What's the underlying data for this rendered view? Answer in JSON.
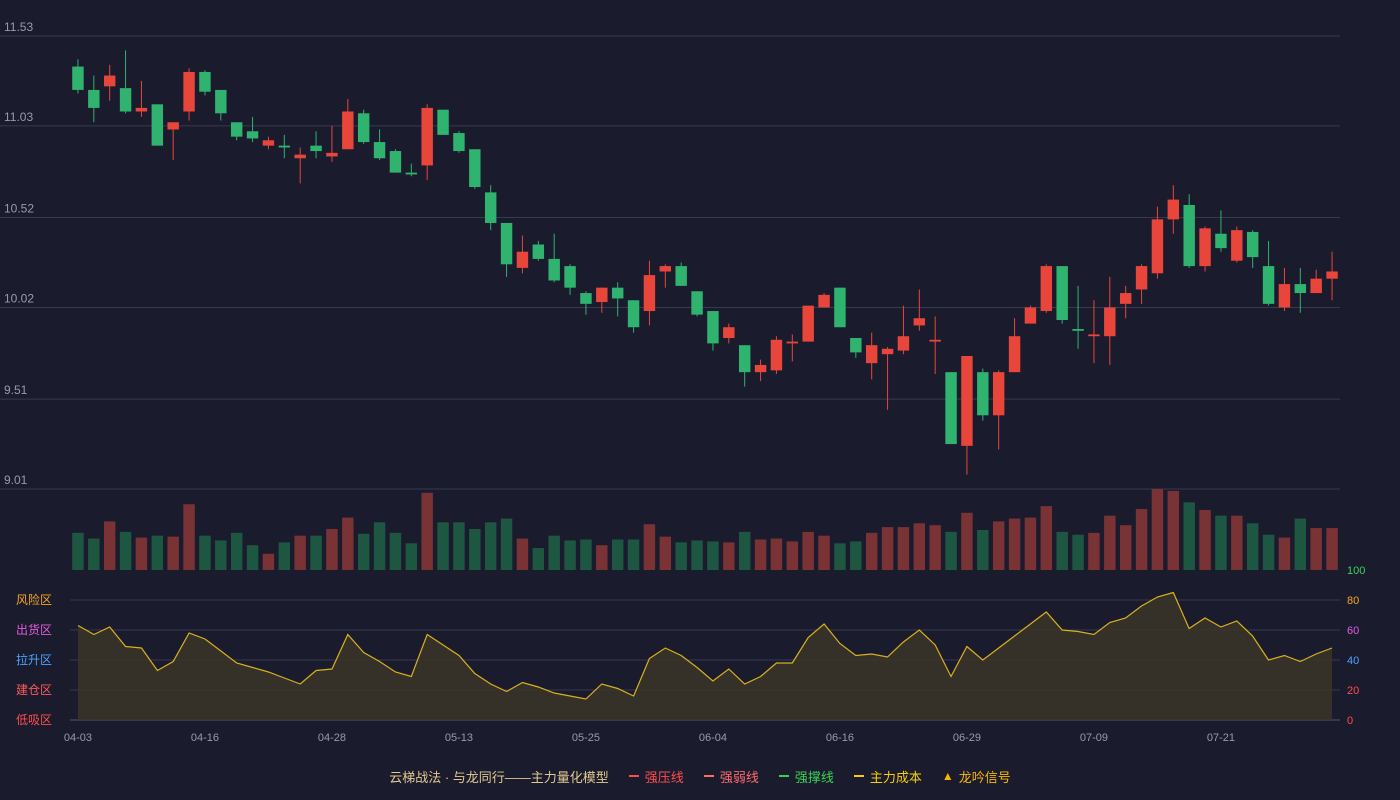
{
  "chart_data": {
    "type": "candlestick",
    "price_axis": {
      "ticks": [
        9.01,
        9.51,
        10.02,
        10.52,
        11.03,
        11.53
      ]
    },
    "x_ticks": [
      "04-03",
      "04-16",
      "04-28",
      "05-13",
      "05-25",
      "06-04",
      "06-16",
      "06-29",
      "07-09",
      "07-21"
    ],
    "x_tick_index": [
      0,
      8,
      16,
      24,
      32,
      40,
      48,
      56,
      64,
      72
    ],
    "candles": [
      [
        11.36,
        11.23,
        11.4,
        11.21
      ],
      [
        11.23,
        11.13,
        11.31,
        11.05
      ],
      [
        11.25,
        11.31,
        11.37,
        11.17
      ],
      [
        11.24,
        11.11,
        11.45,
        11.1
      ],
      [
        11.11,
        11.13,
        11.28,
        11.08
      ],
      [
        11.15,
        10.92,
        11.15,
        10.92
      ],
      [
        11.01,
        11.05,
        11.05,
        10.84
      ],
      [
        11.11,
        11.33,
        11.35,
        11.06
      ],
      [
        11.33,
        11.22,
        11.34,
        11.2
      ],
      [
        11.23,
        11.1,
        11.23,
        11.06
      ],
      [
        11.05,
        10.97,
        11.05,
        10.95
      ],
      [
        11.0,
        10.96,
        11.08,
        10.94
      ],
      [
        10.92,
        10.95,
        10.97,
        10.9
      ],
      [
        10.92,
        10.91,
        10.98,
        10.85
      ],
      [
        10.85,
        10.87,
        10.91,
        10.71
      ],
      [
        10.92,
        10.89,
        11.0,
        10.85
      ],
      [
        10.86,
        10.88,
        11.03,
        10.83
      ],
      [
        10.9,
        11.11,
        11.18,
        10.9
      ],
      [
        11.1,
        10.94,
        11.12,
        10.93
      ],
      [
        10.94,
        10.85,
        11.01,
        10.84
      ],
      [
        10.89,
        10.77,
        10.9,
        10.77
      ],
      [
        10.77,
        10.76,
        10.82,
        10.75
      ],
      [
        10.81,
        11.13,
        11.15,
        10.73
      ],
      [
        11.12,
        10.98,
        11.12,
        10.98
      ],
      [
        10.99,
        10.89,
        11.0,
        10.88
      ],
      [
        10.9,
        10.69,
        10.9,
        10.68
      ],
      [
        10.66,
        10.49,
        10.7,
        10.45
      ],
      [
        10.49,
        10.26,
        10.49,
        10.19
      ],
      [
        10.24,
        10.33,
        10.42,
        10.21
      ],
      [
        10.37,
        10.29,
        10.39,
        10.28
      ],
      [
        10.29,
        10.17,
        10.43,
        10.16
      ],
      [
        10.25,
        10.13,
        10.26,
        10.09
      ],
      [
        10.1,
        10.04,
        10.11,
        9.98
      ],
      [
        10.05,
        10.13,
        10.13,
        9.99
      ],
      [
        10.13,
        10.07,
        10.16,
        9.97
      ],
      [
        10.06,
        9.91,
        10.06,
        9.88
      ],
      [
        10.0,
        10.2,
        10.28,
        9.92
      ],
      [
        10.22,
        10.25,
        10.26,
        10.13
      ],
      [
        10.25,
        10.14,
        10.27,
        10.14
      ],
      [
        10.11,
        9.98,
        10.11,
        9.97
      ],
      [
        10.0,
        9.82,
        10.0,
        9.78
      ],
      [
        9.85,
        9.91,
        9.93,
        9.82
      ],
      [
        9.81,
        9.66,
        9.81,
        9.58
      ],
      [
        9.66,
        9.7,
        9.73,
        9.61
      ],
      [
        9.67,
        9.84,
        9.86,
        9.65
      ],
      [
        9.82,
        9.83,
        9.87,
        9.72
      ],
      [
        9.83,
        10.03,
        10.03,
        9.83
      ],
      [
        10.02,
        10.09,
        10.1,
        10.02
      ],
      [
        10.13,
        9.91,
        10.13,
        9.91
      ],
      [
        9.85,
        9.77,
        9.85,
        9.74
      ],
      [
        9.71,
        9.81,
        9.88,
        9.62
      ],
      [
        9.76,
        9.79,
        9.8,
        9.45
      ],
      [
        9.78,
        9.86,
        10.03,
        9.76
      ],
      [
        9.92,
        9.96,
        10.12,
        9.89
      ],
      [
        9.83,
        9.84,
        9.97,
        9.65
      ],
      [
        9.66,
        9.26,
        9.66,
        9.26
      ],
      [
        9.25,
        9.75,
        9.75,
        9.09
      ],
      [
        9.66,
        9.42,
        9.68,
        9.39
      ],
      [
        9.42,
        9.66,
        9.67,
        9.23
      ],
      [
        9.66,
        9.86,
        9.96,
        9.66
      ],
      [
        9.93,
        10.02,
        10.03,
        9.95
      ],
      [
        10.0,
        10.25,
        10.26,
        9.99
      ],
      [
        10.25,
        9.95,
        10.25,
        9.93
      ],
      [
        9.9,
        9.89,
        10.14,
        9.79
      ],
      [
        9.86,
        9.87,
        10.06,
        9.71
      ],
      [
        9.86,
        10.02,
        10.19,
        9.7
      ],
      [
        10.04,
        10.1,
        10.14,
        9.96
      ],
      [
        10.12,
        10.25,
        10.26,
        10.04
      ],
      [
        10.21,
        10.51,
        10.58,
        10.18
      ],
      [
        10.51,
        10.62,
        10.7,
        10.43
      ],
      [
        10.59,
        10.25,
        10.65,
        10.24
      ],
      [
        10.25,
        10.46,
        10.47,
        10.22
      ],
      [
        10.43,
        10.35,
        10.56,
        10.33
      ],
      [
        10.28,
        10.45,
        10.47,
        10.27
      ],
      [
        10.44,
        10.3,
        10.45,
        10.24
      ],
      [
        10.25,
        10.04,
        10.39,
        10.03
      ],
      [
        10.02,
        10.15,
        10.24,
        10.0
      ],
      [
        10.15,
        10.1,
        10.24,
        9.99
      ],
      [
        10.1,
        10.18,
        10.23,
        10.1
      ],
      [
        10.18,
        10.22,
        10.33,
        10.06
      ]
    ],
    "volumes": [
      39,
      33,
      51,
      40,
      34,
      36,
      35,
      69,
      36,
      31,
      39,
      26,
      17,
      29,
      36,
      36,
      43,
      55,
      38,
      50,
      39,
      28,
      81,
      50,
      50,
      43,
      50,
      54,
      33,
      23,
      36,
      31,
      32,
      26,
      32,
      32,
      48,
      35,
      29,
      31,
      30,
      29,
      40,
      32,
      33,
      30,
      40,
      36,
      28,
      30,
      39,
      45,
      45,
      49,
      47,
      40,
      60,
      42,
      51,
      54,
      55,
      67,
      40,
      37,
      39,
      57,
      47,
      64,
      85,
      83,
      71,
      63,
      57,
      57,
      49,
      37,
      34,
      54,
      44,
      44
    ],
    "oscillator": {
      "ticks": [
        0,
        20,
        40,
        60,
        80,
        100
      ],
      "zone_labels": [
        "风险区",
        "出货区",
        "拉升区",
        "建仓区",
        "低吸区"
      ],
      "values": [
        63,
        57,
        62,
        49,
        48,
        33,
        39,
        58,
        54,
        46,
        38,
        35,
        32,
        28,
        24,
        33,
        34,
        57,
        45,
        39,
        32,
        29,
        57,
        50,
        43,
        31,
        24,
        19,
        25,
        22,
        18,
        16,
        14,
        24,
        21,
        16,
        41,
        48,
        43,
        35,
        26,
        34,
        24,
        29,
        38,
        38,
        55,
        64,
        51,
        43,
        44,
        42,
        52,
        60,
        50,
        29,
        49,
        40,
        48,
        56,
        64,
        72,
        60,
        59,
        57,
        65,
        68,
        76,
        82,
        85,
        61,
        68,
        62,
        66,
        56,
        40,
        43,
        39,
        44,
        48
      ]
    },
    "legend": [
      "云梯战法 · 与龙同行——主力量化模型",
      "强压线",
      "强弱线",
      "强撑线",
      "主力成本",
      "龙吟信号"
    ]
  },
  "colors": {
    "up": "#e8463b",
    "down": "#2fb36e",
    "vol_up": "#7a3334",
    "vol_down": "#1e5741",
    "grid": "#3a3a4e",
    "axis_text": "#9a9aaa",
    "osc_line": "#d8b11d",
    "osc_fill": "#3a3528",
    "zone_colors": [
      "#f5a623",
      "#e05be0",
      "#4aa3ff",
      "#ff5a5a",
      "#ff4d4d"
    ],
    "osc_tick_colors": [
      "#ff4d4d",
      "#ff4d4d",
      "#4aa3ff",
      "#e05be0",
      "#f5a623",
      "#39d353"
    ],
    "legend_colors": [
      "#e0c890",
      "#ff4d4d",
      "#ff6b6b",
      "#39d353",
      "#f5d000",
      "#f5b800"
    ]
  }
}
